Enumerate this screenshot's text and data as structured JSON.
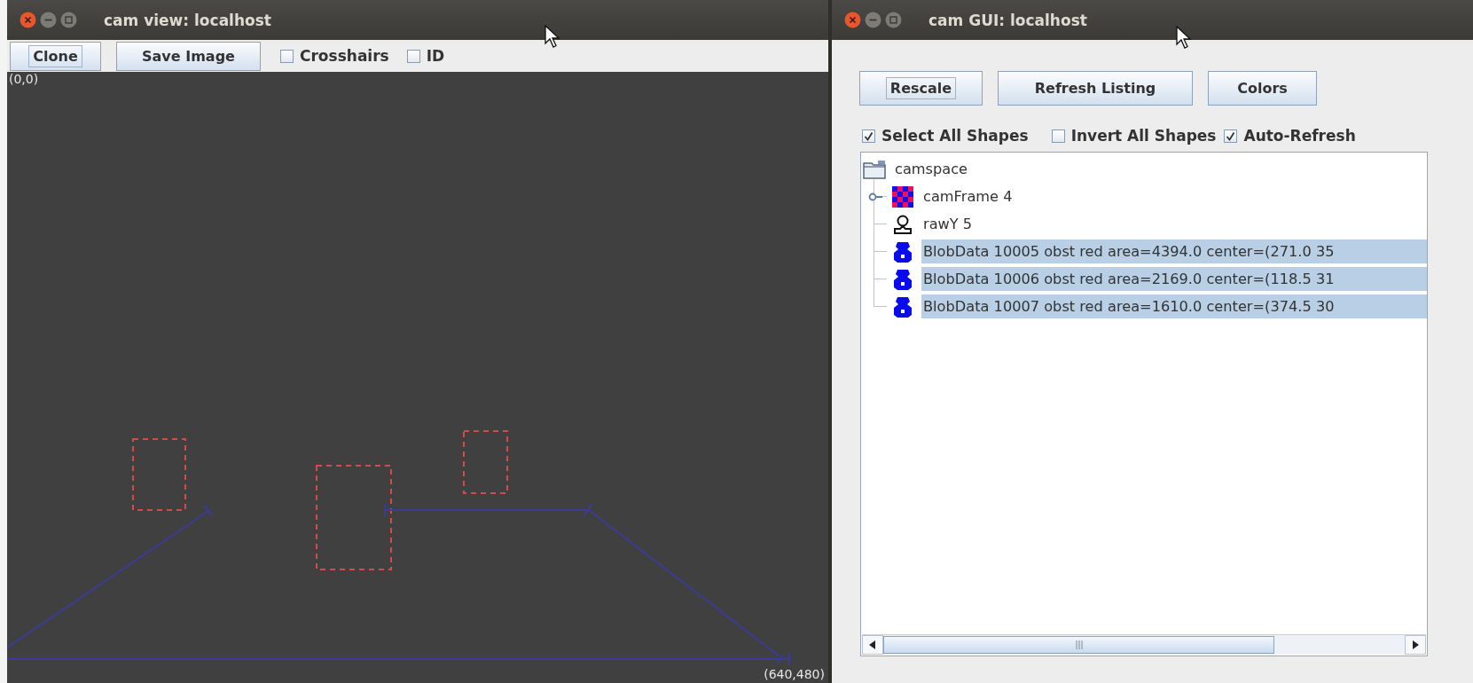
{
  "view_window": {
    "title": "cam view: localhost",
    "buttons": [
      {
        "label": "Clone",
        "focused": true
      },
      {
        "label": "Save Image",
        "focused": false
      }
    ],
    "checkboxes": [
      {
        "label": "Crosshairs",
        "checked": false
      },
      {
        "label": "ID",
        "checked": false
      }
    ],
    "canvas": {
      "origin_label": "(0,0)",
      "extent_label": "(640,480)"
    }
  },
  "gui_window": {
    "title": "cam GUI: localhost",
    "buttons": [
      {
        "label": "Rescale",
        "focused": true
      },
      {
        "label": "Refresh Listing",
        "focused": false
      },
      {
        "label": "Colors",
        "focused": false
      }
    ],
    "checkboxes": [
      {
        "label": "Select All Shapes",
        "checked": true
      },
      {
        "label": "Invert All Shapes",
        "checked": false
      },
      {
        "label": "Auto-Refresh",
        "checked": true
      }
    ],
    "tree": {
      "label": "camspace",
      "children": [
        {
          "kind": "frame",
          "label": "camFrame 4",
          "expanded": false,
          "selected": false
        },
        {
          "kind": "raw",
          "label": "rawY 5",
          "selected": false
        },
        {
          "kind": "blob",
          "label": "BlobData 10005 obst red area=4394.0 center=(271.0 35",
          "selected": true
        },
        {
          "kind": "blob",
          "label": "BlobData 10006 obst red area=2169.0 center=(118.5 31",
          "selected": true
        },
        {
          "kind": "blob",
          "label": "BlobData 10007 obst red area=1610.0 center=(374.5 30",
          "selected": true
        }
      ]
    }
  }
}
